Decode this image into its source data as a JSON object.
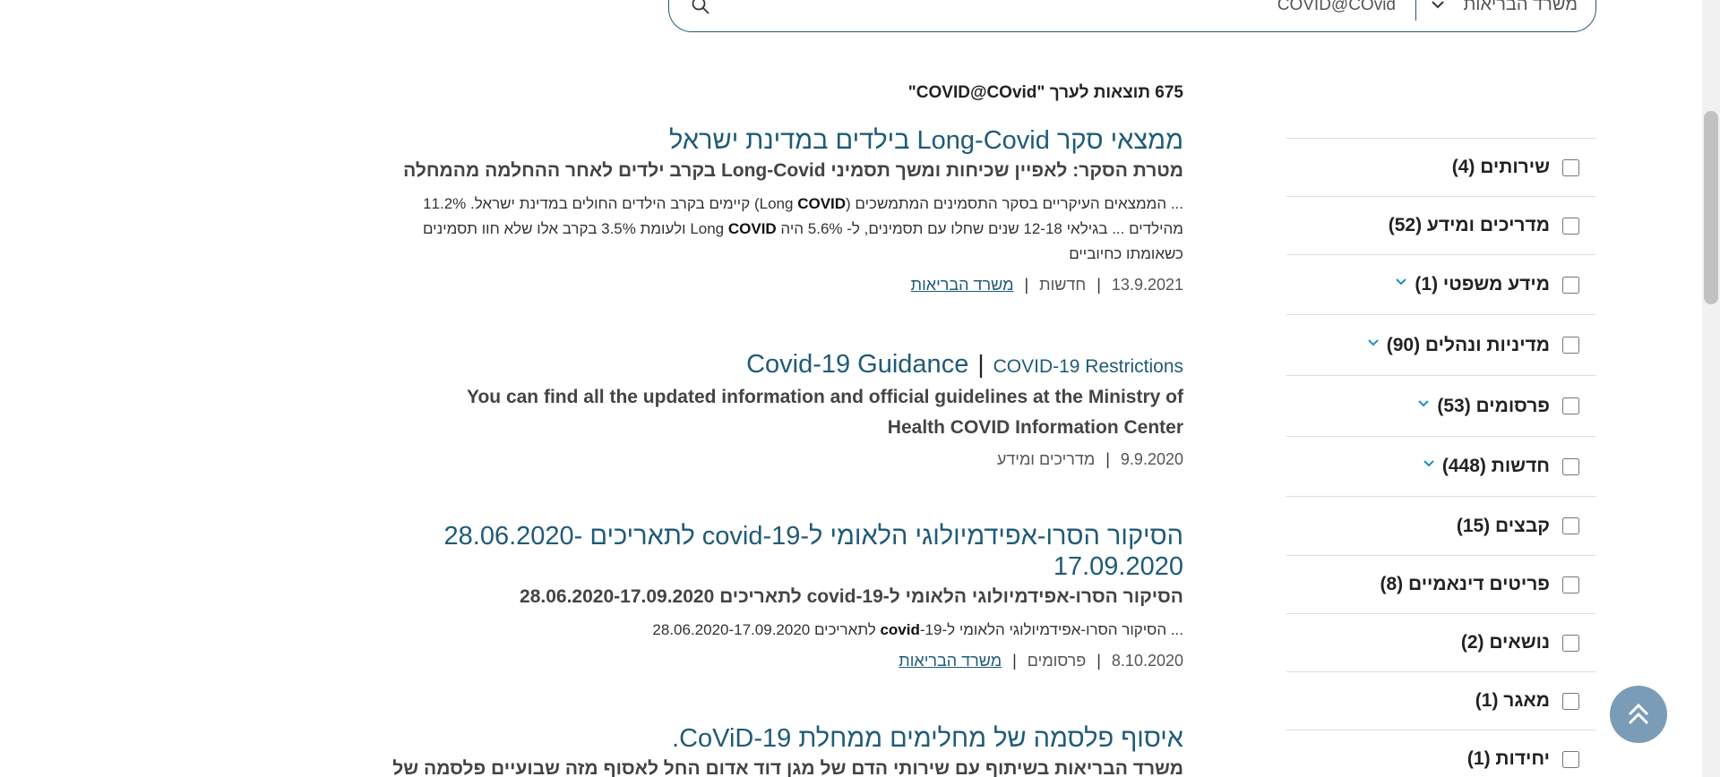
{
  "search": {
    "scope": "משרד הבריאות",
    "query": "COVID@COvid"
  },
  "results_header": {
    "count_text": "675 תוצאות לערך \"COVID@COvid\""
  },
  "results": [
    {
      "title": "ממצאי סקר Long-Covid בילדים במדינת ישראל",
      "subtitle": "מטרת הסקר: לאפיין שכיחות ומשך תסמיני Long-Covid בקרב ילדים לאחר ההחלמה מהמחלה",
      "snippet_1a": "... הממצאים העיקריים בסקר התסמינים המתמשכים (Long ",
      "snippet_1b": "COVID",
      "snippet_1c": ") קיימים בקרב הילדים החולים במדינת ישראל. 11.2%",
      "snippet_2a": "מהילדים ... בגילאי 12-18 שנים שחלו עם תסמינים, ל- 5.6% היה Long ",
      "snippet_2b": "COVID",
      "snippet_2c": " ולעומת 3.5% בקרב אלו שלא חוו תסמינים",
      "snippet_3": "כשאומתו כחיוביים",
      "date": "13.9.2021",
      "category": "חדשות",
      "source": "משרד הבריאות"
    },
    {
      "title": "Covid-19 Guidance",
      "title_sub": "COVID-19 Restrictions",
      "subtitle_1": "You can find all the updated information and official guidelines at the Ministry of",
      "subtitle_2": "Health COVID Information Center",
      "date": "9.9.2020",
      "category": "מדריכים ומידע"
    },
    {
      "title_1": "הסיקור הסרו-אפידמיולוגי הלאומי ל-covid-19 לתאריכים -28.06.2020",
      "title_2": "17.09.2020",
      "subtitle": "הסיקור הסרו-אפידמיולוגי הלאומי ל-covid-19 לתאריכים 28.06.2020-17.09.2020",
      "snippet_a": "... הסיקור הסרו-אפידמיולוגי הלאומי ל-",
      "snippet_b": "covid",
      "snippet_c": "-19 לתאריכים 28.06.2020-17.09.2020",
      "date": "8.10.2020",
      "category": "פרסומים",
      "source": "משרד הבריאות"
    },
    {
      "title": "איסוף פלסמה של מחלימים ממחלת CoViD-19.",
      "subtitle": "משרד הבריאות בשיתוף עם שירותי הדם של מגן דוד אדום החל לאסוף מזה שבועיים פלסמה של"
    }
  ],
  "filters": [
    {
      "label": "שירותים (4)",
      "expandable": false
    },
    {
      "label": "מדריכים ומידע (52)",
      "expandable": false
    },
    {
      "label": "מידע משפטי (1)",
      "expandable": true
    },
    {
      "label": "מדיניות ונהלים (90)",
      "expandable": true
    },
    {
      "label": "פרסומים (53)",
      "expandable": true
    },
    {
      "label": "חדשות (448)",
      "expandable": true
    },
    {
      "label": "קבצים (15)",
      "expandable": false
    },
    {
      "label": "פריטים דינאמיים (8)",
      "expandable": false
    },
    {
      "label": "נושאים (2)",
      "expandable": false
    },
    {
      "label": "מאגר (1)",
      "expandable": false
    },
    {
      "label": "יחידות (1)",
      "expandable": false
    }
  ],
  "colors": {
    "accent": "#1f5b78",
    "chevron": "#1a8fc9",
    "back_to_top": "#7b9cb6"
  },
  "icons": {
    "search": "search-icon",
    "scope_chevron": "chevron-down-icon",
    "back_to_top": "double-chevron-up-icon"
  }
}
